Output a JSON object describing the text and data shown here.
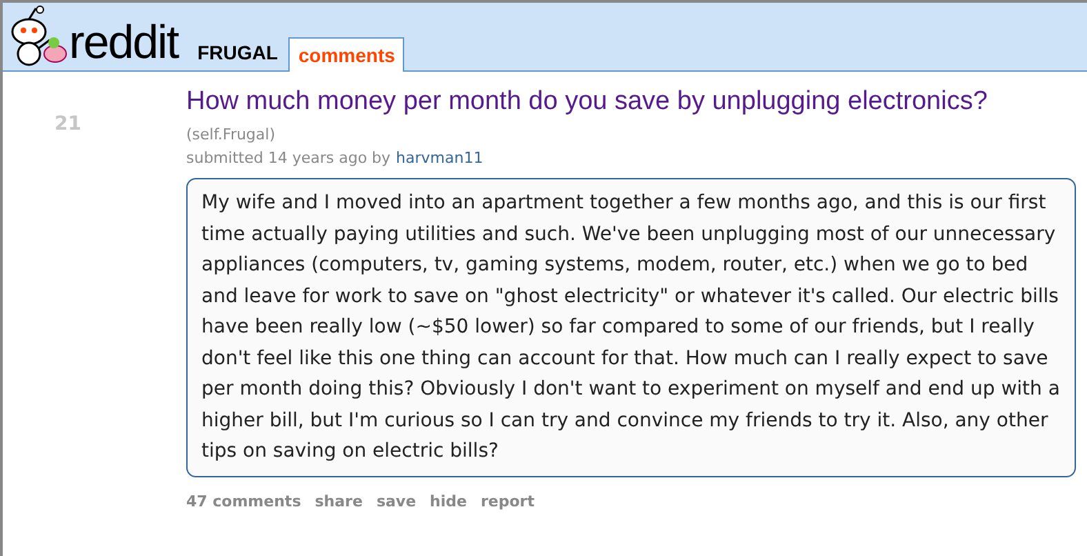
{
  "header": {
    "logo_text": "reddit",
    "subreddit": "FRUGAL",
    "tabs": [
      {
        "label": "comments",
        "selected": true
      }
    ]
  },
  "post": {
    "rank": "21",
    "title": "How much money per month do you save by unplugging electronics?",
    "domain": "(self.Frugal)",
    "submitted": "submitted 14 years ago by",
    "author": "harvman11",
    "body": "My wife and I moved into an apartment together a few months ago, and this is our first time actually paying utilities and such. We've been unplugging most of our unnecessary appliances (computers, tv, gaming systems, modem, router, etc.) when we go to bed and leave for work to save on \"ghost electricity\" or whatever it's called. Our electric bills have been really low (~$50 lower) so far compared to some of our friends, but I really don't feel like this one thing can account for that. How much can I really expect to save per month doing this? Obviously I don't want to experiment on myself and end up with a higher bill, but I'm curious so I can try and convince my friends to try it. Also, any other tips on saving on electric bills?",
    "actions": [
      "47 comments",
      "share",
      "save",
      "hide",
      "report"
    ]
  }
}
